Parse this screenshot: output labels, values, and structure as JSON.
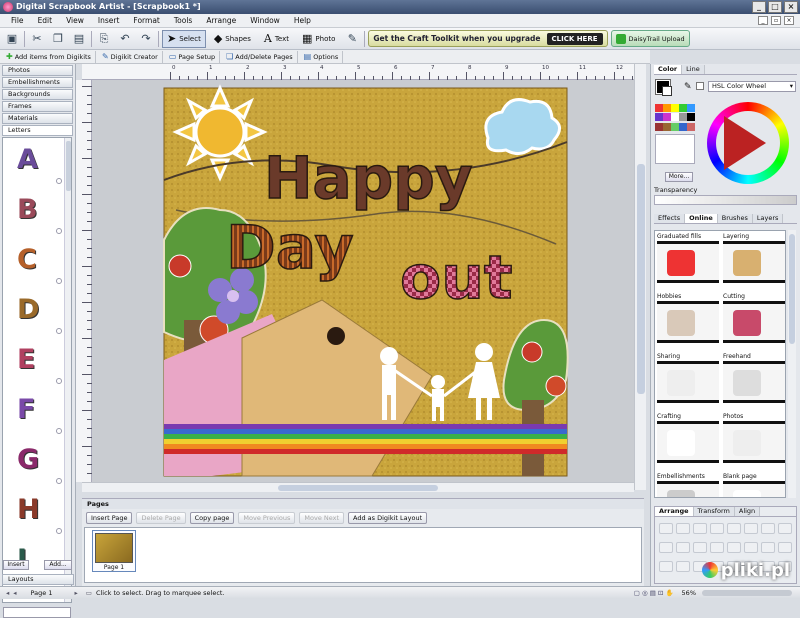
{
  "window": {
    "title": "Digital Scrapbook Artist - [Scrapbook1 *]",
    "controls": [
      "_",
      "□",
      "×"
    ]
  },
  "menu": [
    "File",
    "Edit",
    "View",
    "Insert",
    "Format",
    "Tools",
    "Arrange",
    "Window",
    "Help"
  ],
  "toolbar": {
    "select_label": "Select",
    "shapes_label": "Shapes",
    "text_label": "Text",
    "photo_label": "Photo",
    "banner_text": "Get the Craft Toolkit when you upgrade",
    "banner_button": "CLICK HERE",
    "daisytrail_label": "DaisyTrail Upload"
  },
  "subtoolbar": {
    "add_items": "Add items from Digikits",
    "digikit_creator": "Digikit Creator",
    "page_setup": "Page Setup",
    "add_delete_pages": "Add/Delete Pages",
    "options": "Options"
  },
  "left_panel": {
    "categories": [
      "Photos",
      "Embellishments",
      "Backgrounds",
      "Frames",
      "Materials",
      "Letters"
    ],
    "letters": [
      {
        "char": "A",
        "color": "#6a4c9a"
      },
      {
        "char": "B",
        "color": "#9a4a5a"
      },
      {
        "char": "C",
        "color": "#b5602a"
      },
      {
        "char": "D",
        "color": "#9a6a2a"
      },
      {
        "char": "E",
        "color": "#b04060"
      },
      {
        "char": "F",
        "color": "#7a4aa8"
      },
      {
        "char": "G",
        "color": "#8a2a6a"
      },
      {
        "char": "H",
        "color": "#8a3a2a"
      },
      {
        "char": "I",
        "color": "#2a5a4a"
      }
    ],
    "insert_button": "Insert",
    "add_button": "Add...",
    "layouts_label": "Layouts"
  },
  "ruler": {
    "top_labels": [
      "0",
      "1",
      "2",
      "3",
      "4",
      "5",
      "6",
      "7",
      "8",
      "9",
      "10",
      "11",
      "12"
    ]
  },
  "canvas": {
    "title_word1": "Happy",
    "title_word2": "Day",
    "title_word3": "out"
  },
  "pages": {
    "header": "Pages",
    "buttons": [
      {
        "label": "Insert Page",
        "enabled": true
      },
      {
        "label": "Delete Page",
        "enabled": false
      },
      {
        "label": "Copy page",
        "enabled": true
      },
      {
        "label": "Move Previous",
        "enabled": false
      },
      {
        "label": "Move Next",
        "enabled": false
      },
      {
        "label": "Add as Digikit Layout",
        "enabled": true
      }
    ],
    "thumb_label": "Page 1"
  },
  "right_panel": {
    "tabs_top": [
      "Color",
      "Line"
    ],
    "color_mode": "HSL Color Wheel",
    "more_button": "More...",
    "transparency_label": "Transparency",
    "tabs_mid": [
      "Effects",
      "Online",
      "Brushes",
      "Layers"
    ],
    "effects": [
      {
        "label": "Graduated fills"
      },
      {
        "label": "Layering"
      },
      {
        "label": "Hobbies"
      },
      {
        "label": "Cutting"
      },
      {
        "label": "Sharing"
      },
      {
        "label": "Freehand"
      },
      {
        "label": "Crafting"
      },
      {
        "label": "Photos"
      },
      {
        "label": "Embellishments"
      },
      {
        "label": "Blank page"
      }
    ],
    "tabs_bottom": [
      "Arrange",
      "Transform",
      "Align"
    ]
  },
  "status": {
    "page": "Page 1",
    "hint": "Click to select. Drag to marquee select.",
    "zoom": "56%"
  },
  "watermark": "pliki.pl"
}
